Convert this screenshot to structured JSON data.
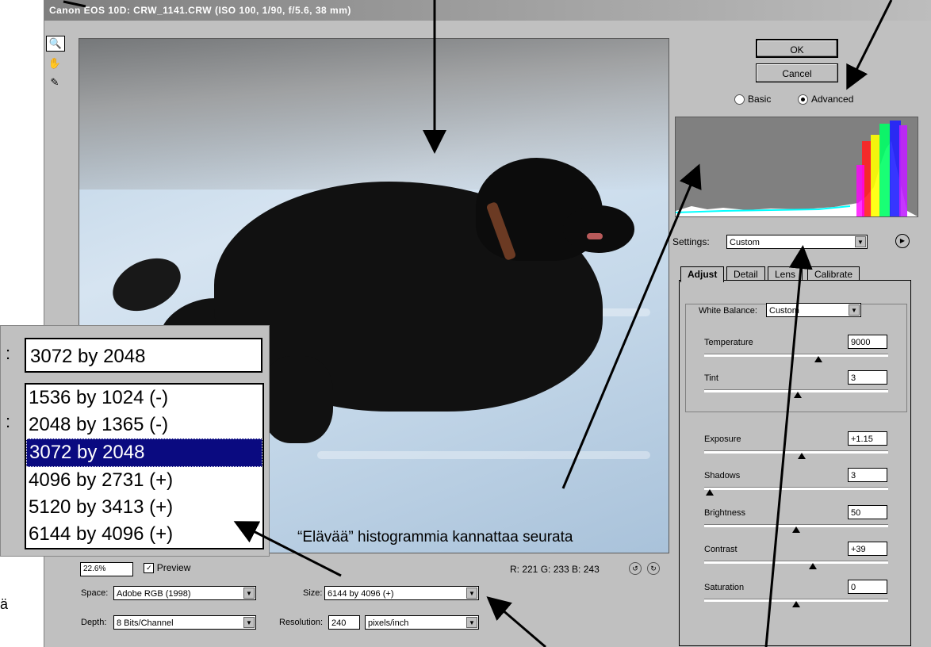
{
  "window": {
    "title": "Canon EOS 10D:  CRW_1141.CRW  (ISO 100, 1/90, f/5.6, 38 mm)"
  },
  "tools": [
    {
      "name": "zoom-tool-icon",
      "glyph": "🔍"
    },
    {
      "name": "hand-tool-icon",
      "glyph": "✋"
    },
    {
      "name": "eyedropper-tool-icon",
      "glyph": "✎"
    }
  ],
  "buttons": {
    "ok": "OK",
    "cancel": "Cancel"
  },
  "mode": {
    "basic": "Basic",
    "advanced": "Advanced",
    "selected": "advanced"
  },
  "annotation": "“Elävää” histogrammia kannattaa seurata",
  "size_callout": {
    "selected": "3072 by 2048",
    "options": [
      "1536 by 1024  (-)",
      "2048 by 1365  (-)",
      "3072 by 2048",
      "4096 by 2731  (+)",
      "5120 by 3413  (+)",
      "6144 by 4096  (+)"
    ],
    "highlighted_index": 2
  },
  "settings": {
    "label": "Settings:",
    "value": "Custom"
  },
  "tabs": [
    "Adjust",
    "Detail",
    "Lens",
    "Calibrate"
  ],
  "white_balance": {
    "label": "White Balance:",
    "value": "Custom"
  },
  "sliders": [
    {
      "label": "Temperature",
      "value": "9000",
      "position": 0.62
    },
    {
      "label": "Tint",
      "value": "3",
      "position": 0.51
    },
    {
      "label": "Exposure",
      "value": "+1.15",
      "position": 0.53
    },
    {
      "label": "Shadows",
      "value": "3",
      "position": 0.03
    },
    {
      "label": "Brightness",
      "value": "50",
      "position": 0.5
    },
    {
      "label": "Contrast",
      "value": "+39",
      "position": 0.59
    },
    {
      "label": "Saturation",
      "value": "0",
      "position": 0.5
    }
  ],
  "readout": "R: 221  G: 233  B: 243",
  "zoom": "22.6%",
  "preview_label": "Preview",
  "space": {
    "label": "Space:",
    "value": "Adobe RGB (1998)"
  },
  "depth": {
    "label": "Depth:",
    "value": "8 Bits/Channel"
  },
  "size": {
    "label": "Size:",
    "value": "6144 by 4096  (+)"
  },
  "resolution": {
    "label": "Resolution:",
    "value": "240",
    "unit": "pixels/inch"
  },
  "left_fragment": "ä",
  "colors": {
    "highlight": "#0a0a80",
    "dialog": "#c0c0c0"
  }
}
